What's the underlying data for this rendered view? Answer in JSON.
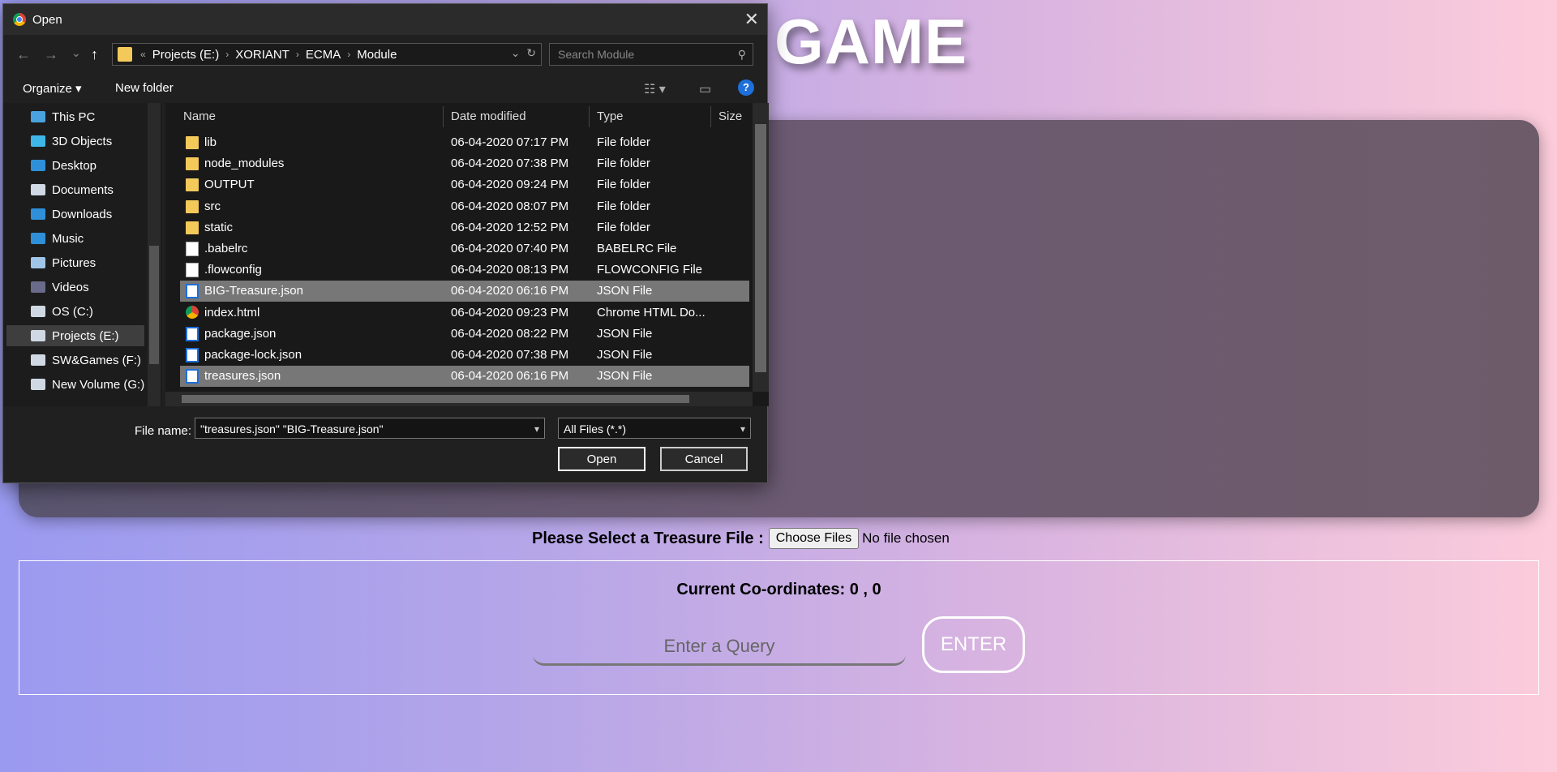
{
  "page": {
    "title": "GAME",
    "file_select_label": "Please Select a Treasure File :",
    "choose_button": "Choose Files",
    "no_file": "No file chosen",
    "coordinates_label": "Current Co-ordinates: 0 , 0",
    "query_placeholder": "Enter a Query",
    "enter_button": "ENTER"
  },
  "dialog": {
    "title": "Open",
    "close": "✕",
    "nav": {
      "back": "←",
      "forward": "→",
      "recent": "⌄",
      "up": "↑"
    },
    "breadcrumb": [
      "«",
      "Projects (E:)",
      "XORIANT",
      "ECMA",
      "Module"
    ],
    "search_placeholder": "Search Module",
    "toolbar": {
      "organize": "Organize ▾",
      "new_folder": "New folder",
      "help": "?"
    },
    "nav_pane": [
      {
        "label": "This PC",
        "icon": "pc-icon",
        "color": "#4aa3df"
      },
      {
        "label": "3D Objects",
        "icon": "cube-icon",
        "color": "#3fb6e8"
      },
      {
        "label": "Desktop",
        "icon": "desktop-icon",
        "color": "#2f8fd8"
      },
      {
        "label": "Documents",
        "icon": "document-icon",
        "color": "#cfd8e3"
      },
      {
        "label": "Downloads",
        "icon": "download-icon",
        "color": "#2f8fd8"
      },
      {
        "label": "Music",
        "icon": "music-icon",
        "color": "#2f8fd8"
      },
      {
        "label": "Pictures",
        "icon": "picture-icon",
        "color": "#9fc6e8"
      },
      {
        "label": "Videos",
        "icon": "video-icon",
        "color": "#6a6a8a"
      },
      {
        "label": "OS (C:)",
        "icon": "drive-icon",
        "color": "#cfd8e3"
      },
      {
        "label": "Projects (E:)",
        "icon": "drive-icon",
        "color": "#cfd8e3",
        "selected": true
      },
      {
        "label": "SW&Games (F:)",
        "icon": "drive-icon",
        "color": "#cfd8e3"
      },
      {
        "label": "New Volume (G:)",
        "icon": "drive-icon",
        "color": "#cfd8e3"
      }
    ],
    "columns": [
      "Name",
      "Date modified",
      "Type",
      "Size"
    ],
    "files": [
      {
        "name": "lib",
        "date": "06-04-2020 07:17 PM",
        "type": "File folder",
        "icon": "folder"
      },
      {
        "name": "node_modules",
        "date": "06-04-2020 07:38 PM",
        "type": "File folder",
        "icon": "folder"
      },
      {
        "name": "OUTPUT",
        "date": "06-04-2020 09:24 PM",
        "type": "File folder",
        "icon": "folder"
      },
      {
        "name": "src",
        "date": "06-04-2020 08:07 PM",
        "type": "File folder",
        "icon": "folder"
      },
      {
        "name": "static",
        "date": "06-04-2020 12:52 PM",
        "type": "File folder",
        "icon": "folder"
      },
      {
        "name": ".babelrc",
        "date": "06-04-2020 07:40 PM",
        "type": "BABELRC File",
        "icon": "file"
      },
      {
        "name": ".flowconfig",
        "date": "06-04-2020 08:13 PM",
        "type": "FLOWCONFIG File",
        "icon": "file"
      },
      {
        "name": "BIG-Treasure.json",
        "date": "06-04-2020 06:16 PM",
        "type": "JSON File",
        "icon": "json",
        "selected": true
      },
      {
        "name": "index.html",
        "date": "06-04-2020 09:23 PM",
        "type": "Chrome HTML Do...",
        "icon": "chrome"
      },
      {
        "name": "package.json",
        "date": "06-04-2020 08:22 PM",
        "type": "JSON File",
        "icon": "json"
      },
      {
        "name": "package-lock.json",
        "date": "06-04-2020 07:38 PM",
        "type": "JSON File",
        "icon": "json"
      },
      {
        "name": "treasures.json",
        "date": "06-04-2020 06:16 PM",
        "type": "JSON File",
        "icon": "json",
        "selected": true
      }
    ],
    "file_name_label": "File name:",
    "file_name_value": "\"treasures.json\" \"BIG-Treasure.json\"",
    "filter_value": "All Files (*.*)",
    "open_button": "Open",
    "cancel_button": "Cancel"
  }
}
